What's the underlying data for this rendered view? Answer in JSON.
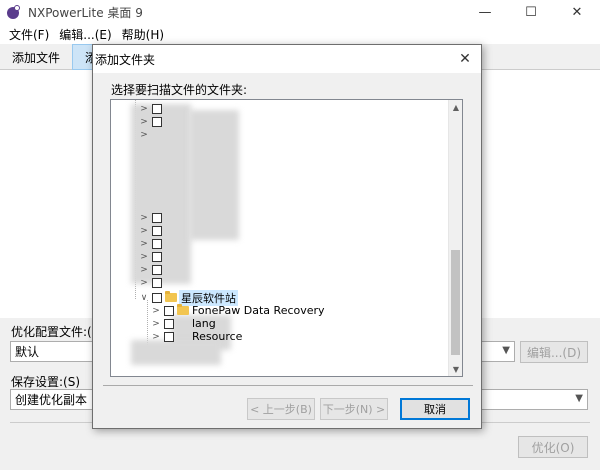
{
  "window": {
    "title": "NXPowerLite 桌面 9",
    "minimize_glyph": "—",
    "maximize_glyph": "☐",
    "close_glyph": "✕"
  },
  "menu": {
    "items": [
      "文件(F)",
      "编辑...(E)",
      "帮助(H)"
    ]
  },
  "toolbar": {
    "add_file": "添加文件",
    "add_folder": "添加"
  },
  "settings": {
    "profile_label": "优化配置文件:(P)",
    "profile_value": "默认",
    "edit_button": "编辑...(D)",
    "save_label": "保存设置:(S)",
    "save_value": "创建优化副本",
    "optimize_button": "优化(O)"
  },
  "dialog": {
    "title": "添加文件夹",
    "close_glyph": "✕",
    "prompt": "选择要扫描文件的文件夹:",
    "tree": {
      "selected": "星辰软件站",
      "children": [
        "FonePaw Data Recovery",
        "lang",
        "Resource"
      ]
    },
    "buttons": {
      "prev": "< 上一步(B)",
      "next": "下一步(N) >",
      "cancel": "取消"
    }
  },
  "icons": {
    "app": "nxpowerlite-logo-icon",
    "folder": "folder-icon",
    "expand": "chevron-right-icon",
    "collapse": "chevron-down-icon"
  },
  "colors": {
    "selection": "#cce8ff",
    "active_tab": "#cde4f7",
    "folder": "#f2c550",
    "primary_border": "#0078d7"
  }
}
